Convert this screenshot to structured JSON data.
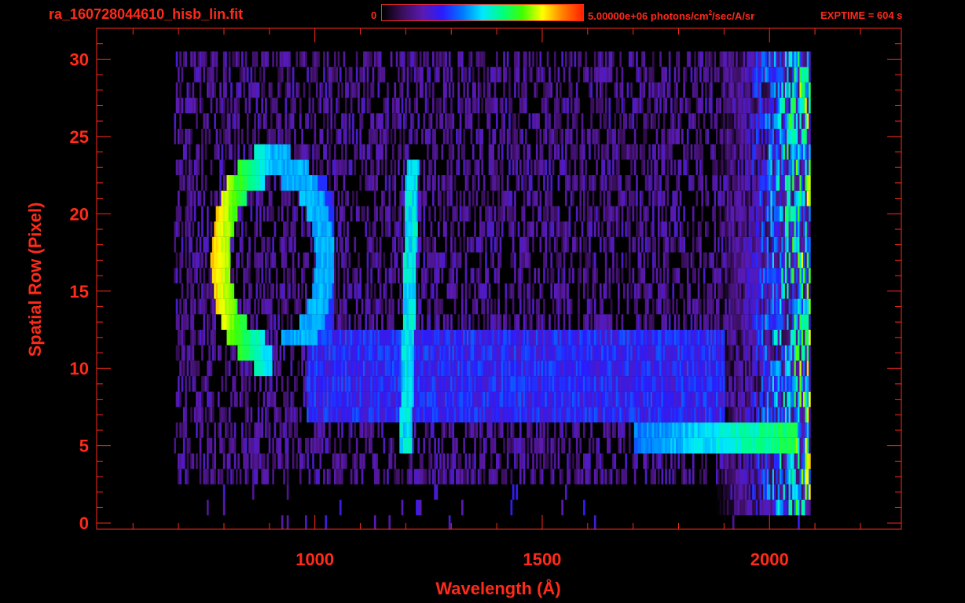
{
  "header": {
    "filename": "ra_160728044610_hisb_lin.fit",
    "colorbar_min": "0",
    "colorbar_max_prefix": "5.00000e+06 photons/cm",
    "colorbar_max_sup": "2",
    "colorbar_max_suffix": "/sec/A/sr",
    "exptime": "EXPTIME = 604 s"
  },
  "colors": {
    "text": "#ff2a1a",
    "axes": "#ff2a1a",
    "background": "#000000",
    "colormap": [
      "#000000",
      "#3a0f5c",
      "#5a1ab0",
      "#2a1cff",
      "#0078ff",
      "#00e8ff",
      "#00ff80",
      "#40ff00",
      "#ffff00",
      "#ff8000",
      "#ff2000"
    ]
  },
  "chart_data": {
    "type": "heatmap",
    "title": "ra_160728044610_hisb_lin.fit",
    "xlabel": "Wavelength (Å)",
    "ylabel": "Spatial Row (Pixel)",
    "xlim": [
      520,
      2290
    ],
    "ylim": [
      -0.4,
      32
    ],
    "x_ticks": [
      1000,
      1500,
      2000
    ],
    "x_tick_labels": [
      "1000",
      "1500",
      "2000"
    ],
    "y_ticks": [
      0,
      5,
      10,
      15,
      20,
      25,
      30
    ],
    "y_tick_labels": [
      "0",
      "5",
      "10",
      "15",
      "20",
      "25",
      "30"
    ],
    "colorbar_range": [
      0,
      5000000
    ],
    "colorbar_units": "photons/cm^2/sec/A/sr",
    "exptime_s": 604,
    "data_extent": {
      "wavelength": [
        690,
        2090
      ],
      "rows": [
        0,
        30
      ]
    },
    "features": [
      {
        "name": "ring-arc",
        "wavelength_range": [
          775,
          1040
        ],
        "rows": [
          11,
          23
        ],
        "peak_wavelength": 810,
        "peak_rows": [
          15,
          18
        ],
        "relative_intensity": 0.85
      },
      {
        "name": "vertical-line",
        "wavelength": 1205,
        "rows": [
          5,
          23
        ],
        "relative_intensity": 0.5
      },
      {
        "name": "horizontal-band",
        "wavelength_range": [
          1700,
          2060
        ],
        "rows": [
          5,
          6
        ],
        "relative_intensity": 0.55
      },
      {
        "name": "red-edge",
        "wavelength_range": [
          1900,
          2060
        ],
        "rows": [
          0,
          30
        ],
        "relative_intensity": 0.7
      }
    ]
  }
}
